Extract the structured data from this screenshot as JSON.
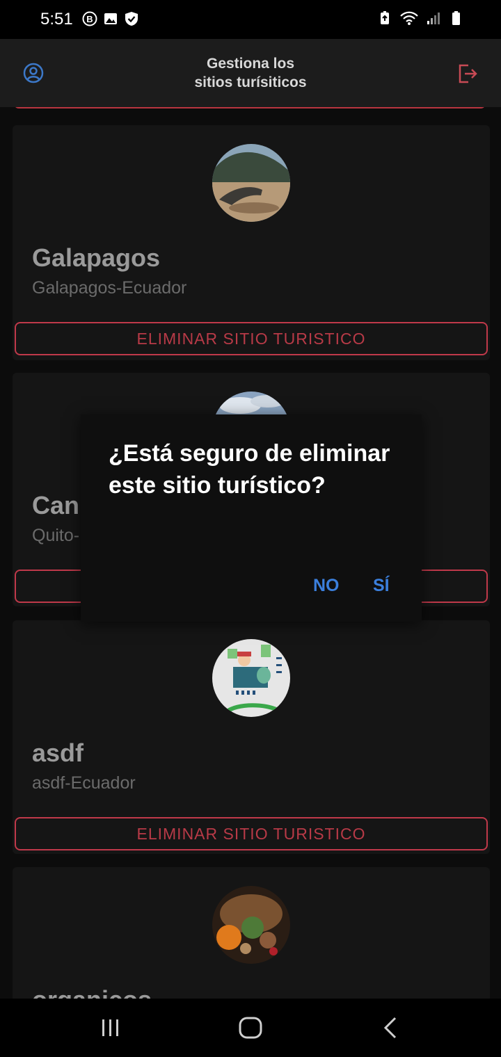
{
  "status": {
    "time": "5:51",
    "left_icons": [
      "b-badge-icon",
      "image-icon",
      "shield-icon"
    ],
    "right_icons": [
      "battery-saver-icon",
      "wifi-icon",
      "signal-icon",
      "battery-icon"
    ]
  },
  "app_bar": {
    "title_line1": "Gestiona los",
    "title_line2": "sitios turísiticos",
    "profile_icon": "account-circle-icon",
    "logout_icon": "logout-icon"
  },
  "cards": [
    {
      "name": "Galapagos",
      "location": "Galapagos-Ecuador",
      "button": "ELIMINAR SITIO TURISTICO",
      "image": "iguana-beach-photo"
    },
    {
      "name": "Can",
      "location": "Quito-",
      "button": "",
      "image": "sky-photo"
    },
    {
      "name": "asdf",
      "location": "asdf-Ecuador",
      "button": "ELIMINAR SITIO TURISTICO",
      "image": "recycling-poster-photo"
    },
    {
      "name": "organicos",
      "location": "",
      "button": "",
      "image": "vegetable-basket-photo"
    }
  ],
  "dialog": {
    "title": "¿Está seguro de eliminar este sitio turístico?",
    "no_label": "NO",
    "yes_label": "SÍ"
  },
  "colors": {
    "accent_red": "#c0394a",
    "dialog_action_blue": "#3b7fdc",
    "card_background": "#151515",
    "app_bar_background": "#1c1c1c"
  }
}
